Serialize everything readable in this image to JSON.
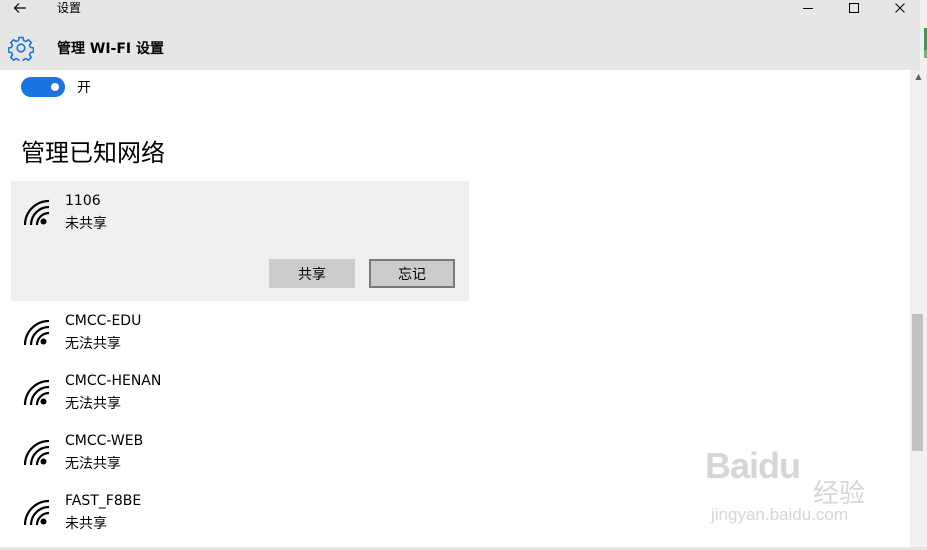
{
  "window": {
    "title": "设置",
    "back_icon": "arrow-left-icon",
    "controls": [
      "minimize-icon",
      "maximize-icon",
      "close-icon"
    ]
  },
  "header": {
    "icon": "gear-icon",
    "title": "管理 WI-FI 设置"
  },
  "toggle": {
    "state": "on",
    "label": "开",
    "color": "#1a73e0"
  },
  "known_networks": {
    "title": "管理已知网络",
    "items": [
      {
        "name": "1106",
        "status": "未共享",
        "selected": true
      },
      {
        "name": "CMCC-EDU",
        "status": "无法共享"
      },
      {
        "name": "CMCC-HENAN",
        "status": "无法共享"
      },
      {
        "name": "CMCC-WEB",
        "status": "无法共享"
      },
      {
        "name": "FAST_F8BE",
        "status": "未共享"
      }
    ],
    "share_button": "共享",
    "forget_button": "忘记"
  },
  "watermark": {
    "logo": "Baidu",
    "cn": "经验",
    "url": "jingyan.baidu.com"
  }
}
